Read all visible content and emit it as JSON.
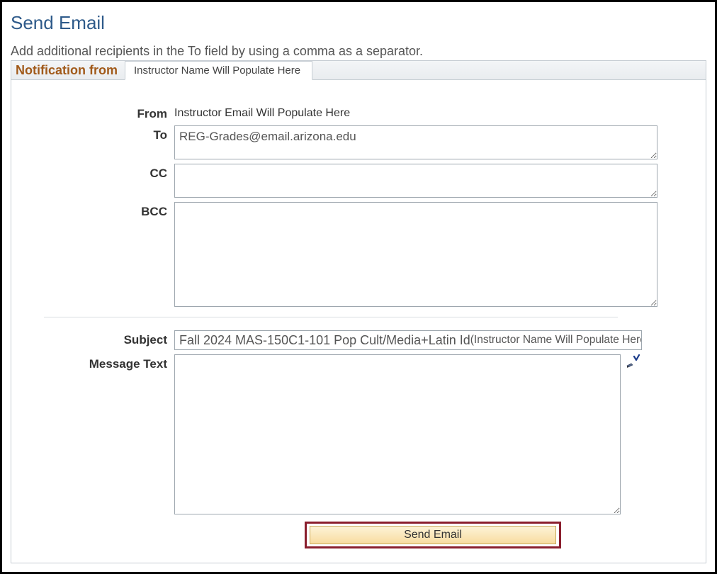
{
  "page": {
    "title": "Send Email",
    "instructions": "Add additional recipients in the To field by using a comma as a separator."
  },
  "tabs": {
    "section_label": "Notification from",
    "active_tab": "Instructor Name Will Populate Here"
  },
  "form": {
    "from_label": "From",
    "from_value": "Instructor Email Will Populate Here",
    "to_label": "To",
    "to_value": "REG-Grades@email.arizona.edu",
    "cc_label": "CC",
    "cc_value": "",
    "bcc_label": "BCC",
    "bcc_value": "",
    "subject_label": "Subject",
    "subject_prefix": "Fall 2024 MAS-150C1-101 Pop Cult/Media+Latin Id ",
    "subject_paren": "(Instructor Name Will Populate Here)",
    "message_label": "Message Text",
    "message_value": ""
  },
  "actions": {
    "send_label": "Send Email"
  }
}
